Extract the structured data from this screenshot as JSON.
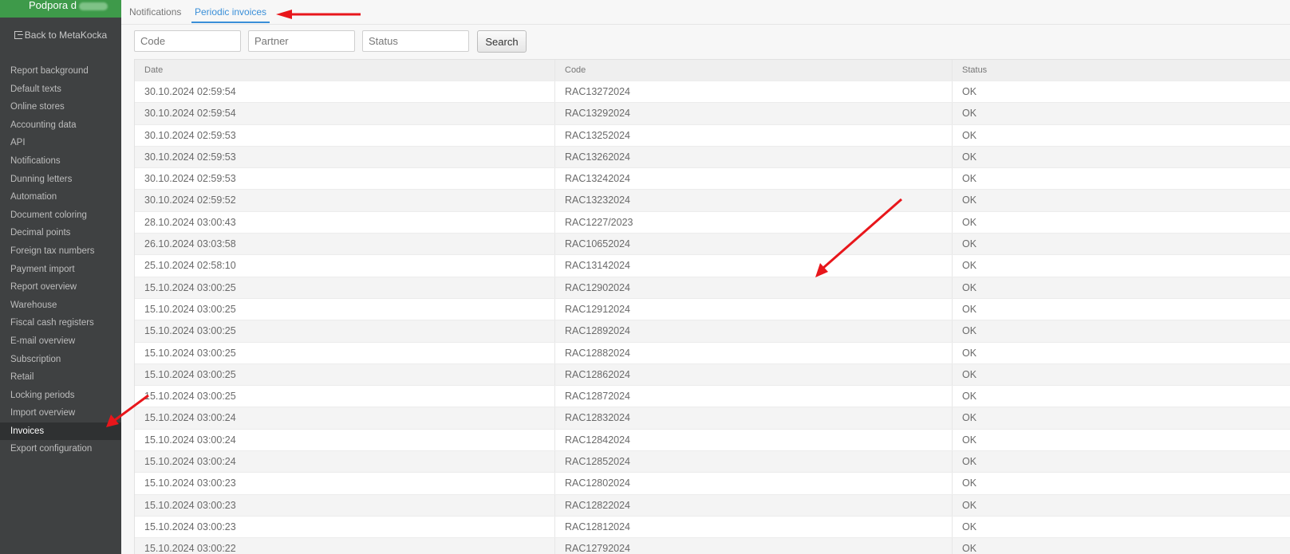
{
  "sidebar": {
    "company": "Podpora d",
    "back_label": "Back to MetaKocka",
    "items": [
      {
        "label": "Report background"
      },
      {
        "label": "Default texts"
      },
      {
        "label": "Online stores"
      },
      {
        "label": "Accounting data"
      },
      {
        "label": "API"
      },
      {
        "label": "Notifications"
      },
      {
        "label": "Dunning letters"
      },
      {
        "label": "Automation"
      },
      {
        "label": "Document coloring"
      },
      {
        "label": "Decimal points"
      },
      {
        "label": "Foreign tax numbers"
      },
      {
        "label": "Payment import"
      },
      {
        "label": "Report overview"
      },
      {
        "label": "Warehouse"
      },
      {
        "label": "Fiscal cash registers"
      },
      {
        "label": "E-mail overview"
      },
      {
        "label": "Subscription"
      },
      {
        "label": "Retail"
      },
      {
        "label": "Locking periods"
      },
      {
        "label": "Import overview"
      },
      {
        "label": "Invoices",
        "active": true
      },
      {
        "label": "Export configuration"
      }
    ]
  },
  "tabs": {
    "notifications": "Notifications",
    "periodic": "Periodic invoices"
  },
  "filters": {
    "code_placeholder": "Code",
    "partner_placeholder": "Partner",
    "status_placeholder": "Status",
    "search_label": "Search"
  },
  "table": {
    "headers": {
      "date": "Date",
      "code": "Code",
      "status": "Status"
    },
    "rows": [
      {
        "date": "30.10.2024 02:59:54",
        "code": "RAC13272024",
        "status": "OK"
      },
      {
        "date": "30.10.2024 02:59:54",
        "code": "RAC13292024",
        "status": "OK"
      },
      {
        "date": "30.10.2024 02:59:53",
        "code": "RAC13252024",
        "status": "OK"
      },
      {
        "date": "30.10.2024 02:59:53",
        "code": "RAC13262024",
        "status": "OK"
      },
      {
        "date": "30.10.2024 02:59:53",
        "code": "RAC13242024",
        "status": "OK"
      },
      {
        "date": "30.10.2024 02:59:52",
        "code": "RAC13232024",
        "status": "OK"
      },
      {
        "date": "28.10.2024 03:00:43",
        "code": "RAC1227/2023",
        "status": "OK"
      },
      {
        "date": "26.10.2024 03:03:58",
        "code": "RAC10652024",
        "status": "OK"
      },
      {
        "date": "25.10.2024 02:58:10",
        "code": "RAC13142024",
        "status": "OK"
      },
      {
        "date": "15.10.2024 03:00:25",
        "code": "RAC12902024",
        "status": "OK"
      },
      {
        "date": "15.10.2024 03:00:25",
        "code": "RAC12912024",
        "status": "OK"
      },
      {
        "date": "15.10.2024 03:00:25",
        "code": "RAC12892024",
        "status": "OK"
      },
      {
        "date": "15.10.2024 03:00:25",
        "code": "RAC12882024",
        "status": "OK"
      },
      {
        "date": "15.10.2024 03:00:25",
        "code": "RAC12862024",
        "status": "OK"
      },
      {
        "date": "15.10.2024 03:00:25",
        "code": "RAC12872024",
        "status": "OK"
      },
      {
        "date": "15.10.2024 03:00:24",
        "code": "RAC12832024",
        "status": "OK"
      },
      {
        "date": "15.10.2024 03:00:24",
        "code": "RAC12842024",
        "status": "OK"
      },
      {
        "date": "15.10.2024 03:00:24",
        "code": "RAC12852024",
        "status": "OK"
      },
      {
        "date": "15.10.2024 03:00:23",
        "code": "RAC12802024",
        "status": "OK"
      },
      {
        "date": "15.10.2024 03:00:23",
        "code": "RAC12822024",
        "status": "OK"
      },
      {
        "date": "15.10.2024 03:00:23",
        "code": "RAC12812024",
        "status": "OK"
      },
      {
        "date": "15.10.2024 03:00:22",
        "code": "RAC12792024",
        "status": "OK"
      }
    ]
  },
  "colors": {
    "sidebar_bg": "#3f4142",
    "company_bar": "#3e9a4a",
    "accent": "#3a8fd8",
    "annotation": "#e8161b"
  }
}
